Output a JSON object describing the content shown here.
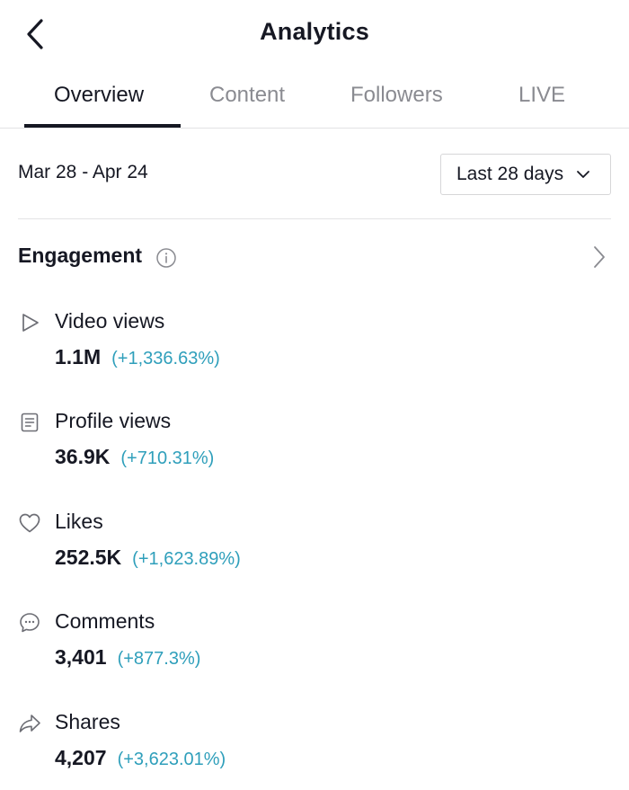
{
  "header": {
    "title": "Analytics",
    "back_icon": "chevron-left-icon"
  },
  "tabs": [
    {
      "label": "Overview",
      "active": true
    },
    {
      "label": "Content",
      "active": false
    },
    {
      "label": "Followers",
      "active": false
    },
    {
      "label": "LIVE",
      "active": false
    }
  ],
  "filter": {
    "date_range": "Mar 28 - Apr 24",
    "period_label": "Last 28 days"
  },
  "engagement": {
    "title": "Engagement",
    "metrics": [
      {
        "label": "Video views",
        "value": "1.1M",
        "change": "(+1,336.63%)",
        "icon": "play-icon"
      },
      {
        "label": "Profile views",
        "value": "36.9K",
        "change": "(+710.31%)",
        "icon": "profile-document-icon"
      },
      {
        "label": "Likes",
        "value": "252.5K",
        "change": "(+1,623.89%)",
        "icon": "heart-icon"
      },
      {
        "label": "Comments",
        "value": "3,401",
        "change": "(+877.3%)",
        "icon": "comment-bubble-icon"
      },
      {
        "label": "Shares",
        "value": "4,207",
        "change": "(+3,623.01%)",
        "icon": "share-arrow-icon"
      }
    ]
  },
  "colors": {
    "text": "#161823",
    "muted": "#8a8b91",
    "positive_change": "#2f9fbb",
    "divider": "#e3e3e4"
  }
}
